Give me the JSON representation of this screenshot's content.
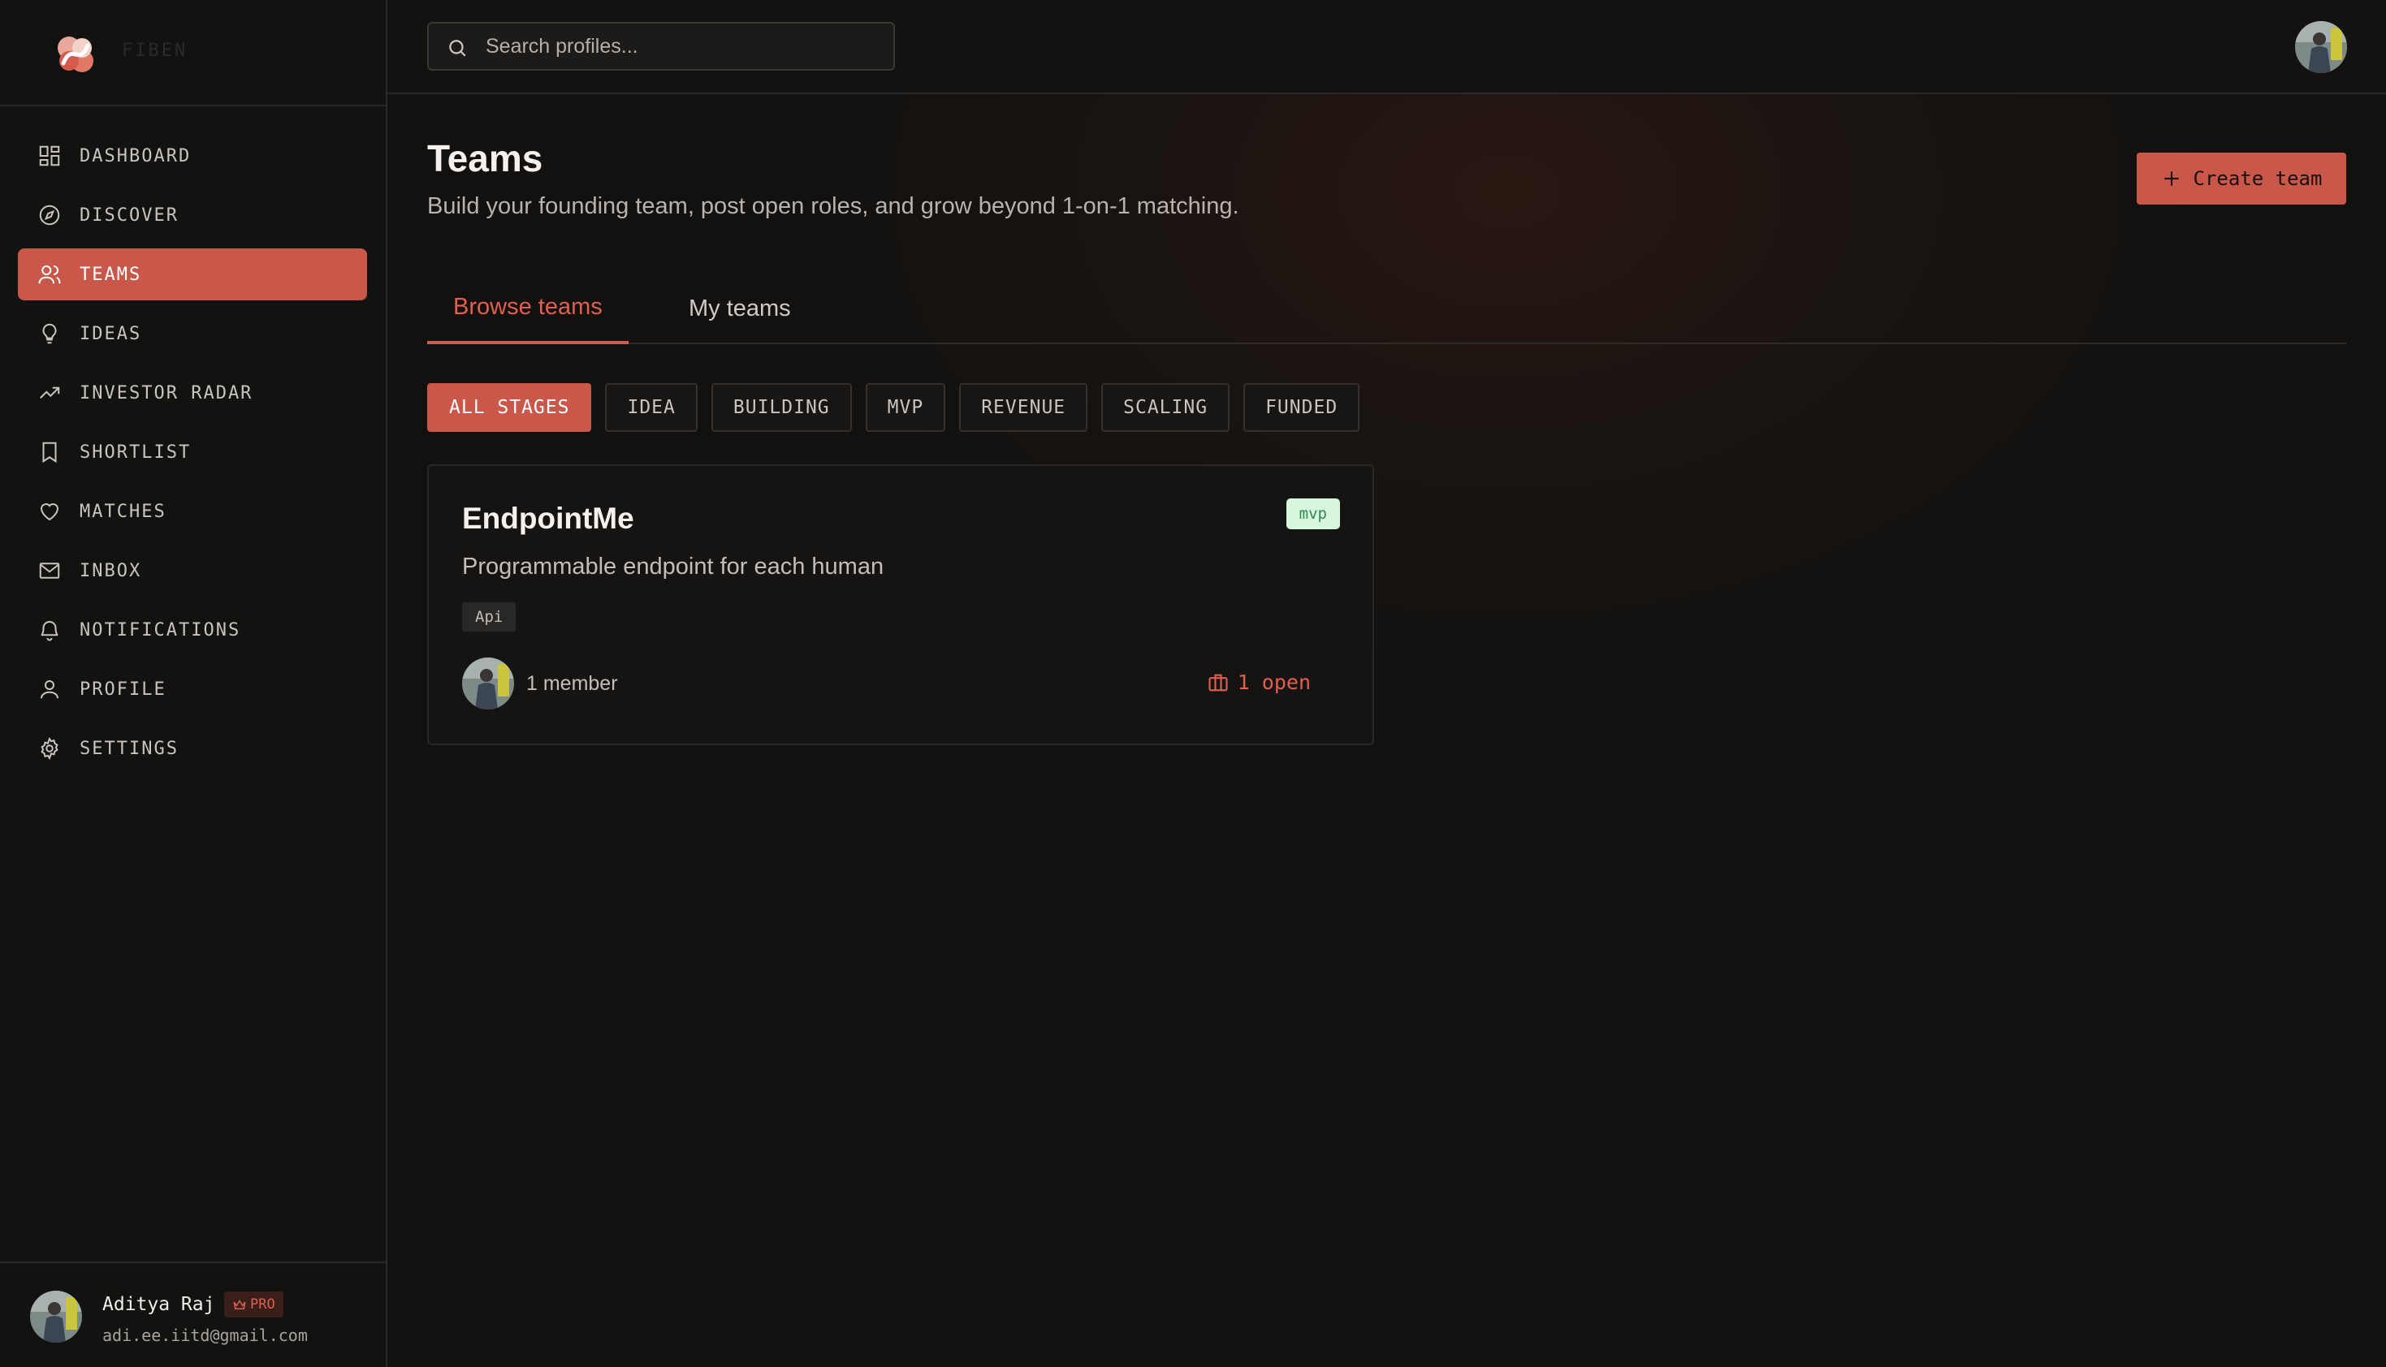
{
  "brand": {
    "name": "FIBEN"
  },
  "nav": {
    "items": [
      {
        "label": "DASHBOARD",
        "icon": "grid-icon"
      },
      {
        "label": "DISCOVER",
        "icon": "compass-icon"
      },
      {
        "label": "TEAMS",
        "icon": "users-icon",
        "active": true
      },
      {
        "label": "IDEAS",
        "icon": "lightbulb-icon"
      },
      {
        "label": "INVESTOR RADAR",
        "icon": "trending-up-icon"
      },
      {
        "label": "SHORTLIST",
        "icon": "bookmark-icon"
      },
      {
        "label": "MATCHES",
        "icon": "heart-icon"
      },
      {
        "label": "INBOX",
        "icon": "mail-icon"
      },
      {
        "label": "NOTIFICATIONS",
        "icon": "bell-icon"
      },
      {
        "label": "PROFILE",
        "icon": "user-icon"
      },
      {
        "label": "SETTINGS",
        "icon": "gear-icon"
      }
    ]
  },
  "user": {
    "name": "Aditya Raj",
    "badge": "PRO",
    "email": "adi.ee.iitd@gmail.com"
  },
  "search": {
    "placeholder": "Search profiles..."
  },
  "page": {
    "title": "Teams",
    "subtitle": "Build your founding team, post open roles, and grow beyond 1-on-1 matching.",
    "create_label": "Create team"
  },
  "tabs": [
    {
      "label": "Browse teams",
      "active": true
    },
    {
      "label": "My teams",
      "active": false
    }
  ],
  "filters": [
    {
      "label": "ALL STAGES",
      "active": true
    },
    {
      "label": "IDEA"
    },
    {
      "label": "BUILDING"
    },
    {
      "label": "MVP"
    },
    {
      "label": "REVENUE"
    },
    {
      "label": "SCALING"
    },
    {
      "label": "FUNDED"
    }
  ],
  "teams": [
    {
      "name": "EndpointMe",
      "description": "Programmable endpoint for each human",
      "tag": "Api",
      "stage": "mvp",
      "members": "1 member",
      "open_roles": "1 open"
    }
  ],
  "colors": {
    "accent": "#C9584A",
    "background": "#121110",
    "stage_badge_bg": "#D8F5DF",
    "stage_badge_fg": "#2F8A4F"
  }
}
